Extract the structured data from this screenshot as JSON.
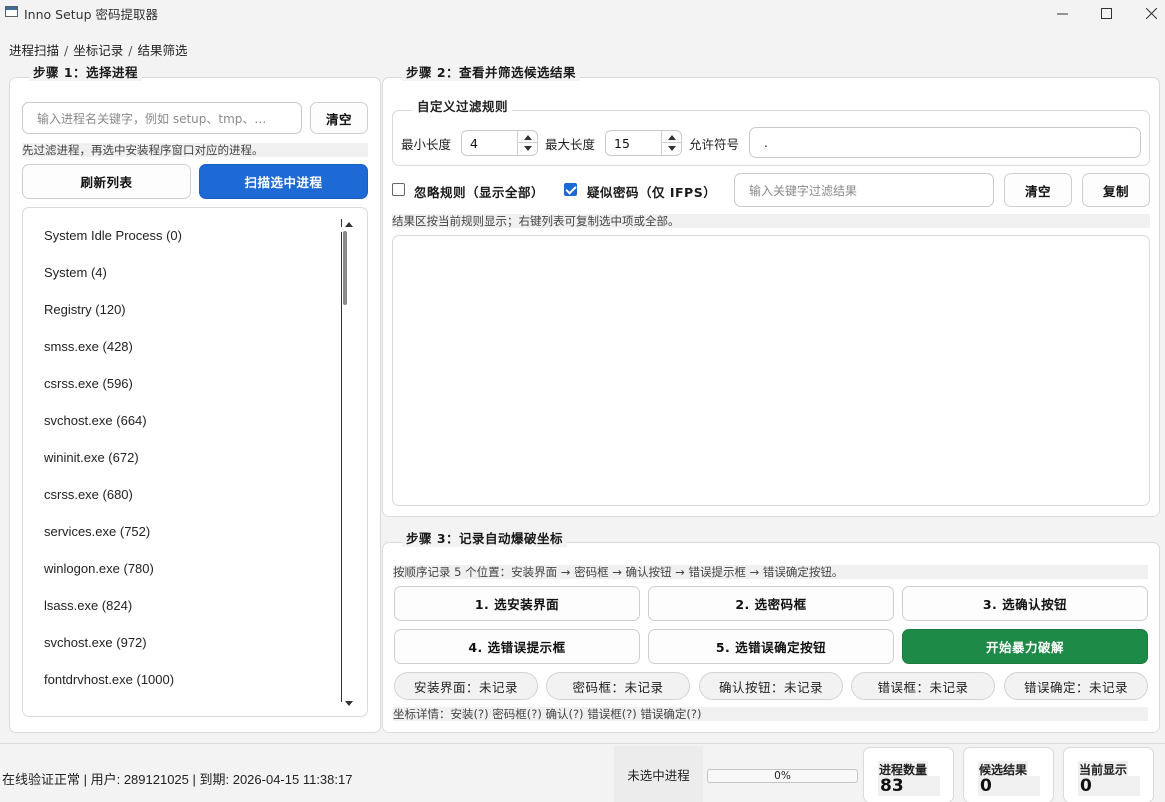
{
  "window": {
    "title": "Inno Setup 密码提取器",
    "controls": [
      "minimize-icon",
      "maximize-icon",
      "close-icon"
    ]
  },
  "breadcrumb": [
    "进程扫描",
    "坐标记录",
    "结果筛选"
  ],
  "step1": {
    "title": "步骤 1：选择进程",
    "search_placeholder": "输入进程名关键字，例如 setup、tmp、…",
    "clear_label": "清空",
    "hint": "先过滤进程，再选中安装程序窗口对应的进程。",
    "refresh_label": "刷新列表",
    "scan_label": "扫描选中进程",
    "processes": [
      "System Idle Process (0)",
      "System (4)",
      "Registry (120)",
      "smss.exe (428)",
      "csrss.exe (596)",
      "svchost.exe (664)",
      "wininit.exe (672)",
      "csrss.exe (680)",
      "services.exe (752)",
      "winlogon.exe (780)",
      "lsass.exe (824)",
      "svchost.exe (972)",
      "fontdrvhost.exe (1000)"
    ]
  },
  "step2": {
    "title": "步骤 2：查看并筛选候选结果",
    "filter_title": "自定义过滤规则",
    "min_len_label": "最小长度",
    "min_len_value": "4",
    "max_len_label": "最大长度",
    "max_len_value": "15",
    "allowed_label": "允许符号",
    "allowed_value": ".",
    "ignore_rules_label": "忽略规则（显示全部）",
    "ignore_rules_checked": false,
    "suspect_label": "疑似密码（仅 IFPS）",
    "suspect_checked": true,
    "keyword_placeholder": "输入关键字过滤结果",
    "clear_label": "清空",
    "copy_label": "复制",
    "hint": "结果区按当前规则显示；右键列表可复制选中项或全部。"
  },
  "step3": {
    "title": "步骤 3：记录自动爆破坐标",
    "hint": "按顺序记录 5 个位置：安装界面 → 密码框 → 确认按钮 → 错误提示框 → 错误确定按钮。",
    "buttons": [
      "1. 选安装界面",
      "2. 选密码框",
      "3. 选确认按钮",
      "4. 选错误提示框",
      "5. 选错误确定按钮"
    ],
    "start_label": "开始暴力破解",
    "pills": [
      "安装界面：未记录",
      "密码框：未记录",
      "确认按钮：未记录",
      "错误框：未记录",
      "错误确定：未记录"
    ],
    "details": "坐标详情：安装(?)  密码框(?)  确认(?)  错误框(?)  错误确定(?)"
  },
  "status": {
    "text": "在线验证正常 | 用户: 289121025 | 到期: 2026-04-15 11:38:17",
    "process": "未选中进程",
    "progress": 0,
    "progress_label": "0%",
    "cards": [
      {
        "label": "进程数量",
        "value": "83"
      },
      {
        "label": "候选结果",
        "value": "0"
      },
      {
        "label": "当前显示",
        "value": "0"
      }
    ]
  },
  "colors": {
    "primary": "#1d69d6",
    "success": "#1e8a48"
  }
}
